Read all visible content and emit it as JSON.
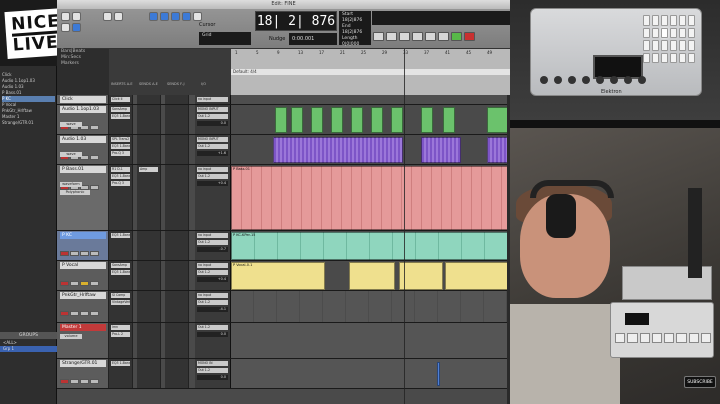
{
  "logo": {
    "line1": "NICE",
    "line2": "LIVE"
  },
  "window": {
    "title": "Edit: FINE"
  },
  "left_pane": {
    "tracks": [
      "Click",
      "Audio 1.1op1.03",
      "Audio 1.03",
      "P Bass.01",
      "P KC",
      "P Vocal",
      "PnkGtr_Hrlftaw",
      "Master 1",
      "Strange/GTR.01"
    ],
    "groups_header": "GROUPS",
    "groups": [
      "<ALL>",
      "Grp 1"
    ]
  },
  "toolbar": {
    "counter": "18| 2| 876",
    "nudge_label": "Nudge",
    "nudge_value": "0:00.001",
    "grid_label": "Grid",
    "cursor_label": "Cursor",
    "lcd_lines": [
      "Start 18|2|876",
      "End 18|2|876",
      "Length 0|0|000"
    ]
  },
  "rulers": {
    "names": [
      "Bars|Beats",
      "Min:Secs",
      "Markers"
    ],
    "bar_numbers": [
      "1",
      "5",
      "9",
      "13",
      "17",
      "21",
      "25",
      "29",
      "33",
      "37",
      "41",
      "45",
      "49"
    ],
    "default_marker": "Default: 4/4"
  },
  "io_header": [
    "INSERTS A-E",
    "SENDS A-E",
    "SENDS F-J",
    "I/O"
  ],
  "track_rows": [
    {
      "name": "Click",
      "color": "#b5b5b5",
      "inserts": [
        "Click II"
      ],
      "sends": [],
      "io": [
        "no input",
        "Out 1-2"
      ],
      "vol": "0.0",
      "clips": []
    },
    {
      "name": "Audio 1.1op1.03",
      "color": "#5fb36d",
      "inserts": [
        "SansAmp",
        "EQ3 1-Band"
      ],
      "sends": [],
      "io": [
        "MONO INPUT",
        "Out 1-2"
      ],
      "vol": "0.0",
      "clips": [
        {
          "label": "",
          "color": "#6bc26c"
        }
      ]
    },
    {
      "name": "Audio 1.03",
      "color": "#7a54c2",
      "inserts": [
        "SPL Trans2",
        "EQ3 1-Band",
        "Pro-Q 3"
      ],
      "sends": [],
      "io": [
        "MONO INPUT",
        "Out 1-2"
      ],
      "vol": "+1.6",
      "clips": [
        {
          "label": "",
          "color": "#8c6ad1"
        }
      ]
    },
    {
      "name": "P Bass.01",
      "color": "#e07e7e",
      "inserts": [
        "R1 D.1",
        "EQ3 1-Band",
        "Pro-Q 3"
      ],
      "sends": [
        "Amp"
      ],
      "io": [
        "no input",
        "Out 1-2"
      ],
      "vol": "+0.4",
      "instrument": "waveform",
      "plugin": "Polyphonic",
      "clips": [
        {
          "label": "P Bass.01",
          "color": "#e59a9a"
        }
      ]
    },
    {
      "name": "P KC",
      "color": "#60bfa6",
      "inserts": [
        "EQ3 1-Band"
      ],
      "sends": [],
      "io": [
        "no input",
        "Out 1-2"
      ],
      "vol": "-0.7",
      "clips": [
        {
          "label": "P KC-KPer-15",
          "color": "#8fd6be"
        }
      ]
    },
    {
      "name": "P Vocal",
      "color": "#e5d46a",
      "inserts": [
        "SansAmp",
        "EQ3 1-Band"
      ],
      "sends": [],
      "io": [
        "no input",
        "Out 1-2"
      ],
      "vol": "+0.4",
      "clips": [
        {
          "label": "P Vocal-0.1",
          "color": "#efe08e"
        }
      ]
    },
    {
      "name": "PnkGtr_Hrlftaw",
      "color": "#c9c9c9",
      "inserts": [
        "SI Comp",
        "VintageVerb"
      ],
      "sends": [],
      "io": [
        "no input",
        "Out 1-2"
      ],
      "vol": "-4.1",
      "clips": []
    },
    {
      "name": "Master 1",
      "color": "#c23a3a",
      "inserts": [
        "Imn",
        "Pro-L 2"
      ],
      "sends": [],
      "io": [
        "Out 1-2"
      ],
      "vol": "0.0",
      "volume_label": "volume",
      "clips": []
    },
    {
      "name": "Strange/GTR.01",
      "color": "#4e7fd6",
      "inserts": [
        "EQ3 1-Band"
      ],
      "sends": [],
      "io": [
        "MONO IN",
        "Out 1-2"
      ],
      "vol": "0.0",
      "clips": []
    }
  ],
  "device": {
    "brand": "Elektron"
  },
  "subscribe": {
    "label": "SUBSCRIBE"
  }
}
